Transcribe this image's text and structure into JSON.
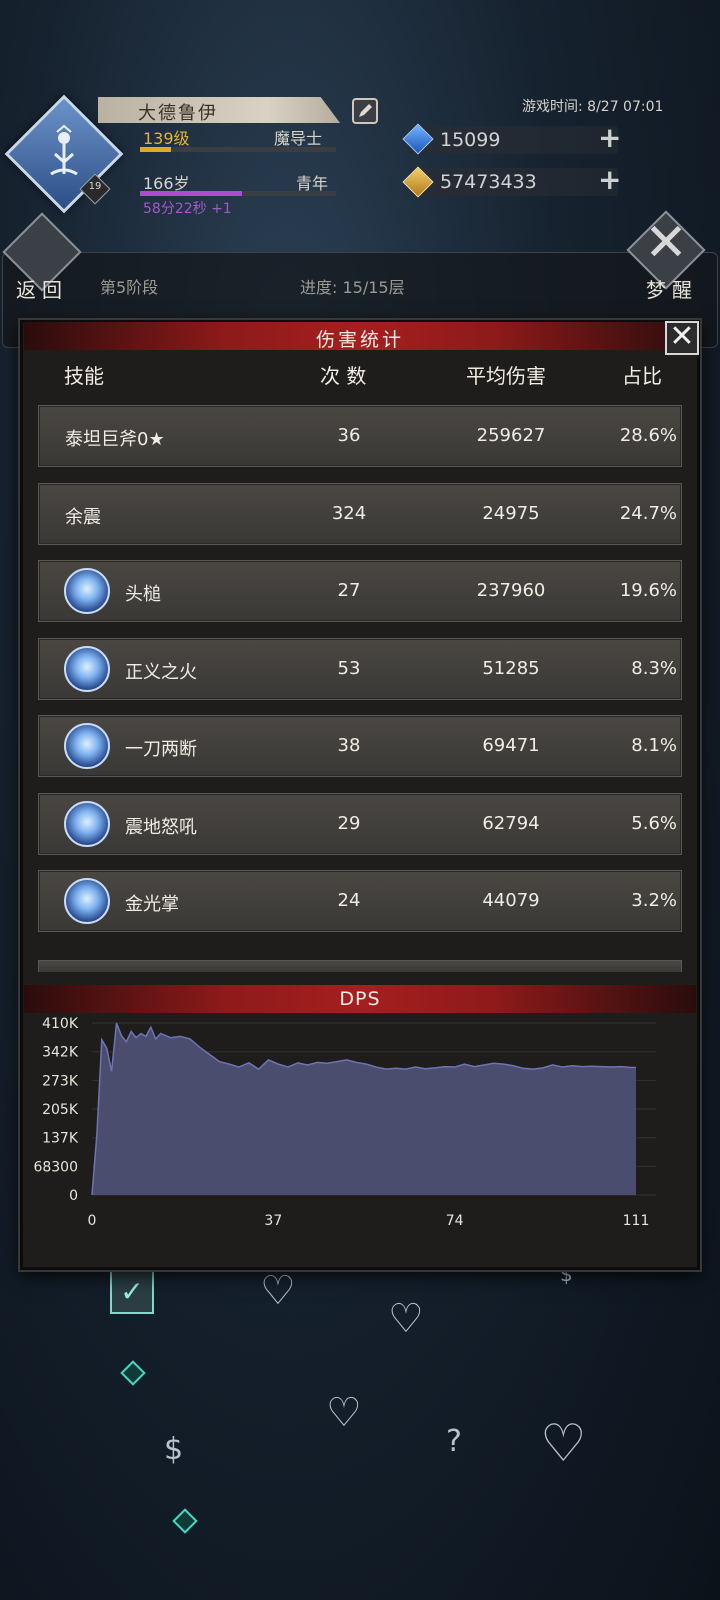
{
  "player": {
    "name": "大德鲁伊",
    "level_text": "139级",
    "class_name": "魔导士",
    "level_progress": 0.16,
    "age_text": "166岁",
    "age_stage": "青年",
    "age_progress": 0.52,
    "timer_text": "58分22秒 +1",
    "badge_level": "19"
  },
  "game_time": "游戏时间: 8/27 07:01",
  "resources": {
    "gems": "15099",
    "gold": "57473433"
  },
  "nav": {
    "back_label": "返回",
    "wake_label": "梦醒",
    "phase_text": "第5阶段",
    "progress_text": "进度: 15/15层"
  },
  "damage_stats": {
    "title": "伤害统计",
    "columns": {
      "skill": "技能",
      "count": "次 数",
      "avg": "平均伤害",
      "share": "占比"
    },
    "rows": [
      {
        "name": "泰坦巨斧0★",
        "count": "36",
        "avg": "259627",
        "share": "28.6%",
        "icon": ""
      },
      {
        "name": "余震",
        "count": "324",
        "avg": "24975",
        "share": "24.7%",
        "icon": ""
      },
      {
        "name": "头槌",
        "count": "27",
        "avg": "237960",
        "share": "19.6%",
        "icon": "claw-slash-icon"
      },
      {
        "name": "正义之火",
        "count": "53",
        "avg": "51285",
        "share": "8.3%",
        "icon": "sword-icon"
      },
      {
        "name": "一刀两断",
        "count": "38",
        "avg": "69471",
        "share": "8.1%",
        "icon": "double-slash-icon"
      },
      {
        "name": "震地怒吼",
        "count": "29",
        "avg": "62794",
        "share": "5.6%",
        "icon": "roar-icon"
      },
      {
        "name": "金光掌",
        "count": "24",
        "avg": "44079",
        "share": "3.2%",
        "icon": "palm-burst-icon"
      }
    ]
  },
  "chart_data": {
    "type": "area",
    "title": "DPS",
    "xlabel": "",
    "ylabel": "",
    "x_ticks": [
      0,
      37,
      74,
      111
    ],
    "y_ticks": [
      "0",
      "68300",
      "137K",
      "205K",
      "273K",
      "342K",
      "410K"
    ],
    "xlim": [
      0,
      111
    ],
    "ylim": [
      0,
      410000
    ],
    "grid": true,
    "fill_color": "#4a4d6e",
    "line_color": "#6e74b3",
    "series": [
      {
        "x": [
          0,
          1,
          2,
          3,
          4,
          5,
          6,
          7,
          8,
          9,
          10,
          11,
          12,
          13,
          14,
          15,
          16,
          18,
          20,
          22,
          24,
          26,
          28,
          30,
          32,
          34,
          36,
          38,
          40,
          42,
          44,
          46,
          48,
          50,
          52,
          54,
          56,
          58,
          60,
          62,
          64,
          66,
          68,
          70,
          72,
          74,
          76,
          78,
          80,
          82,
          84,
          86,
          88,
          90,
          92,
          94,
          96,
          98,
          100,
          102,
          104,
          106,
          108,
          110,
          111
        ],
        "y": [
          0,
          145000,
          370000,
          350000,
          295000,
          410000,
          380000,
          365000,
          390000,
          375000,
          385000,
          378000,
          400000,
          372000,
          385000,
          380000,
          375000,
          378000,
          372000,
          352000,
          335000,
          318000,
          312000,
          305000,
          315000,
          300000,
          322000,
          312000,
          305000,
          315000,
          310000,
          316000,
          314000,
          318000,
          322000,
          316000,
          312000,
          305000,
          300000,
          302000,
          300000,
          305000,
          301000,
          303000,
          306000,
          305000,
          312000,
          306000,
          310000,
          314000,
          312000,
          308000,
          302000,
          300000,
          303000,
          310000,
          305000,
          308000,
          306000,
          307000,
          306000,
          305000,
          306000,
          304000,
          304000
        ]
      }
    ]
  },
  "map": {
    "nodes": [
      "heart-helm-icon",
      "heart-helm-icon",
      "heart-helm-icon",
      "heart-helm-icon",
      "money-bag-icon",
      "chest-icon",
      "mystery-icon",
      "boss-helm-icon"
    ]
  }
}
